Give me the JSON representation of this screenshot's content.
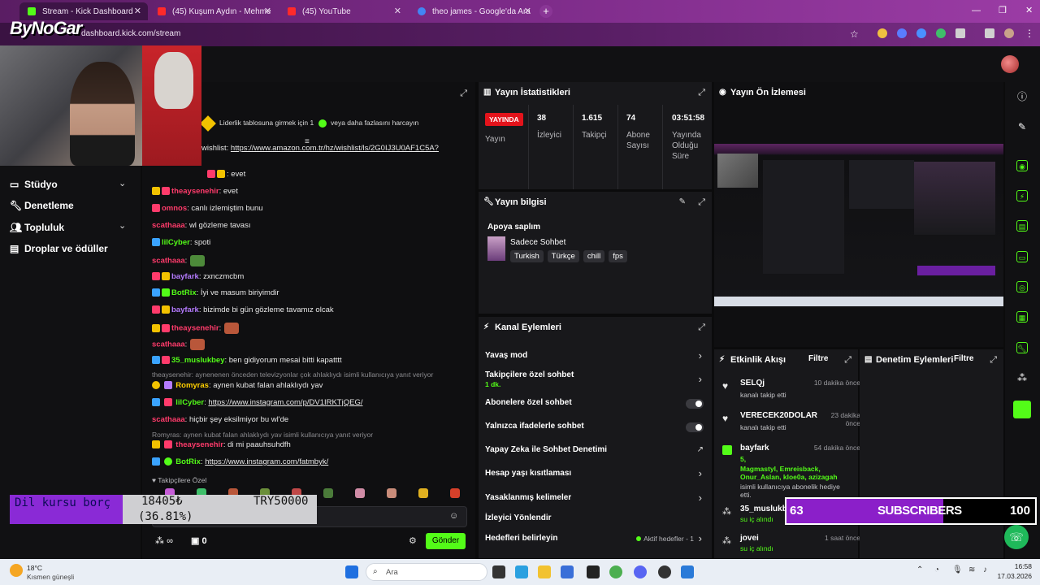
{
  "browser": {
    "tabs": [
      {
        "label": "Stream - Kick Dashboard",
        "color": "#53fc18"
      },
      {
        "label": "(45) Kuşum Aydın - Mehme",
        "color": "#ff2a2a"
      },
      {
        "label": "(45) YouTube",
        "color": "#ff2a2a"
      },
      {
        "label": "theo james - Google'da Ara",
        "color": "#4285f4"
      }
    ],
    "url": "dashboard.kick.com/stream"
  },
  "overlay": {
    "logo": "ByNoGar",
    "goal_label": "Dil kursu borç",
    "goal_amount": "18405₺",
    "goal_percent": "(36.81%)",
    "goal_target": "TRY50000",
    "goal_progress": 0.3681,
    "subs_current": "63",
    "subs_label": "SUBSCRIBERS",
    "subs_goal": "100",
    "subs_progress": 0.63
  },
  "sidebar": {
    "items": [
      {
        "label": "Stüdyo",
        "has_chevron": true
      },
      {
        "label": "Denetleme",
        "has_chevron": false
      },
      {
        "label": "Topluluk",
        "has_chevron": true
      },
      {
        "label": "Droplar ve ödüller",
        "has_chevron": false
      }
    ]
  },
  "chat": {
    "leaderboard_text": "Liderlik tablosuna girmek için 1",
    "leaderboard_text2": "veya daha fazlasını harcayın",
    "wishlist_prefix": "wishlist:",
    "wishlist_link": "https://www.amazon.com.tr/hz/wishlist/ls/2G0IJ3U0AF1C5A?",
    "messages": [
      {
        "user": "",
        "text": ": evet",
        "color": "#e8e8e8"
      },
      {
        "user": "theaysenehir",
        "text": ": evet",
        "color": "#ff3b6b"
      },
      {
        "user": "omnos",
        "text": ": canlı izlemiştim bunu",
        "color": "#ff3b6b"
      },
      {
        "user": "scathaaa",
        "text": ": wl gözleme tavası",
        "color": "#ff3b6b"
      },
      {
        "user": "lilCyber",
        "text": ": spoti",
        "color": "#53fc18"
      },
      {
        "user": "scathaaa",
        "text": ":",
        "color": "#ff3b6b"
      },
      {
        "user": "bayfark",
        "text": ": zxnczmcbm",
        "color": "#b57bff"
      },
      {
        "user": "BotRix",
        "text": ": İyi ve masum biriyimdir",
        "color": "#53fc18"
      },
      {
        "user": "bayfark",
        "text": ": bizimde bi gün gözleme tavamız olcak",
        "color": "#b57bff"
      },
      {
        "user": "theaysenehir",
        "text": ":",
        "color": "#ff3b6b"
      },
      {
        "user": "scathaaa",
        "text": ":",
        "color": "#ff3b6b"
      },
      {
        "user": "35_muslukbey",
        "text": ": ben gidiyorum mesai bitti kapatttt",
        "color": "#53fc18"
      }
    ],
    "reply1": "theaysenehir: aynenenen önceden televizyonlar çok ahlaklıydı isimli kullanıcıya yanıt veriyor",
    "msg_romyras_user": "Romyras",
    "msg_romyras_text": ": aynen kubat falan ahlaklıydı yav",
    "msg_lilcyber2_user": "lilCyber",
    "msg_lilcyber2_link": "https://www.instagram.com/p/DV1IRKTjQEG/",
    "msg_scathaaa_user": "scathaaa",
    "msg_scathaaa_text": ": hiçbir şey eksilmiyor bu wl'de",
    "reply2": "Romyras: aynen kubat falan ahlaklıydı yav isimli kullanıcıya yanıt veriyor",
    "msg_theay_user": "theaysenehir",
    "msg_theay_text": ": di mi paauhsuhdfh",
    "msg_botrix_user": "BotRix",
    "msg_botrix_link": "https://www.instagram.com/fatmbyk/",
    "followers_only": "Takipçilere Özel",
    "points_count": "∞",
    "gift_count": "0",
    "send_button": "Gönder"
  },
  "stats": {
    "title": "Yayın İstatistikleri",
    "live_badge": "YAYINDA",
    "live_label": "Yayın",
    "viewers_value": "38",
    "viewers_label": "İzleyici",
    "followers_value": "1.615",
    "followers_label": "Takipçi",
    "subs_value": "74",
    "subs_label1": "Abone",
    "subs_label2": "Sayısı",
    "uptime_value": "03:51:58",
    "uptime_label1": "Yayında",
    "uptime_label2": "Olduğu",
    "uptime_label3": "Süre"
  },
  "preview": {
    "title": "Yayın Ön İzlemesi"
  },
  "stream_info": {
    "title": "Yayın bilgisi",
    "stream_title": "Apoya saplım",
    "category": "Sadece Sohbet",
    "tags": [
      "Turkish",
      "Türkçe",
      "chill",
      "fps"
    ]
  },
  "channel_actions": {
    "title": "Kanal Eylemleri",
    "slow_mode": "Yavaş mod",
    "followers_chat": "Takipçilere özel sohbet",
    "followers_chat_sub": "1 dk.",
    "subs_chat": "Abonelere özel sohbet",
    "emote_chat": "Yalnızca ifadelerle sohbet",
    "ai_mod": "Yapay Zeka ile Sohbet Denetimi",
    "age_limit": "Hesap yaşı kısıtlaması",
    "banned_words": "Yasaklanmış kelimeler",
    "raid": "İzleyici Yönlendir",
    "goals": "Hedefleri belirleyin",
    "goals_status": "Aktif hedefler - 1"
  },
  "activity": {
    "title": "Etkinlik Akışı",
    "filter": "Filtre",
    "events": [
      {
        "name": "SELQj",
        "sub": "kanalı takip etti",
        "time": "10 dakika önce"
      },
      {
        "name": "VERECEK20DOLAR",
        "sub": "kanalı takip etti",
        "time": "23 dakika önce"
      },
      {
        "name": "bayfark",
        "sub": "isimli kullanıcıya abonelik hediye etti.",
        "time": "54 dakika önce",
        "gift": "5,",
        "gift_names": "Magmastyl, Emreisback, Onur_Aslan, kloe0a, azizagah"
      },
      {
        "name": "35_muslukb",
        "sub": "su iç alındı",
        "time": ""
      },
      {
        "name": "jovei",
        "sub": "su iç alındı",
        "time": "1 saat önce"
      }
    ]
  },
  "moderation": {
    "title": "Denetim Eylemleri",
    "filter": "Filtre"
  },
  "taskbar": {
    "weather_temp": "18°C",
    "weather_desc": "Kısmen güneşli",
    "search": "Ara",
    "time": "16:58",
    "date": "17.03.2026"
  }
}
